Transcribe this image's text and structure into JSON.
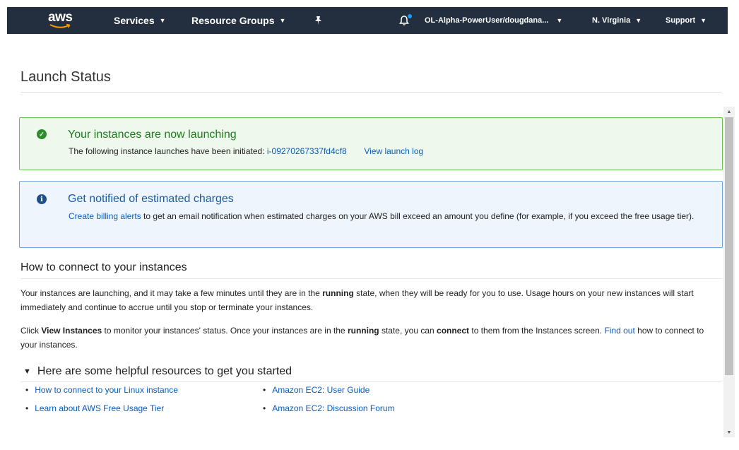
{
  "nav": {
    "logo": "aws",
    "services": "Services",
    "resource_groups": "Resource Groups",
    "account": "OL-Alpha-PowerUser/dougdana...",
    "region": "N. Virginia",
    "support": "Support"
  },
  "page": {
    "title": "Launch Status"
  },
  "success_alert": {
    "heading": "Your instances are now launching",
    "text": "The following instance launches have been initiated:",
    "instance_id": "i-09270267337fd4cf8",
    "view_log": "View launch log"
  },
  "info_alert": {
    "heading": "Get notified of estimated charges",
    "link": "Create billing alerts",
    "text": " to get an email notification when estimated charges on your AWS bill exceed an amount you define (for example, if you exceed the free usage tier)."
  },
  "connect": {
    "heading": "How to connect to your instances",
    "p1_a": "Your instances are launching, and it may take a few minutes until they are in the ",
    "p1_b": "running",
    "p1_c": " state, when they will be ready for you to use. Usage hours on your new instances will start immediately and continue to accrue until you stop or terminate your instances.",
    "p2_a": "Click ",
    "p2_b": "View Instances",
    "p2_c": " to monitor your instances' status. Once your instances are in the ",
    "p2_d": "running",
    "p2_e": " state, you can ",
    "p2_f": "connect",
    "p2_g": " to them from the Instances screen. ",
    "p2_link": "Find out",
    "p2_h": " how to connect to your instances."
  },
  "resources": {
    "heading": "Here are some helpful resources to get you started",
    "items": [
      "How to connect to your Linux instance",
      "Amazon EC2: User Guide",
      "Learn about AWS Free Usage Tier",
      "Amazon EC2: Discussion Forum"
    ]
  },
  "colors": {
    "nav_bg": "#232f3e",
    "success_border": "#6cbf59",
    "success_bg": "#eff8ec",
    "info_border": "#6ea5d8",
    "info_bg": "#eef5fc",
    "link": "#0a5cbf"
  },
  "icons": {
    "bell": "bell-icon",
    "pin": "pin-icon",
    "success": "check-circle-icon",
    "info": "info-circle-icon"
  }
}
